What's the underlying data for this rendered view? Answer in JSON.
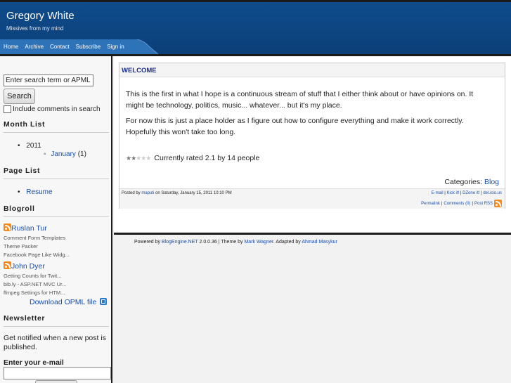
{
  "header": {
    "title": "Gregory White",
    "subtitle": "Missives from my mind",
    "nav": [
      "Home",
      "Archive",
      "Contact",
      "Subscribe",
      "Sign in"
    ]
  },
  "sidebar": {
    "search": {
      "value": "Enter search term or APML url",
      "button": "Search",
      "checkbox_label": "Include comments in search",
      "checked": false
    },
    "month_list": {
      "heading": "Month List",
      "year": "2011",
      "month": "January",
      "count": "(1)"
    },
    "page_list": {
      "heading": "Page List",
      "items": [
        "Resume"
      ]
    },
    "blogroll": {
      "heading": "Blogroll",
      "blogs": [
        {
          "name": "Ruslan Tur",
          "posts": [
            "Comment Form Templates",
            "Theme Packer",
            "Facebook Page Like Widg..."
          ]
        },
        {
          "name": "John Dyer",
          "posts": [
            "Getting Counts for Twit...",
            "bib.ly - ASP.NET MVC Ur...",
            "ffmpeg Settings for HTM..."
          ]
        }
      ],
      "opml": "Download OPML file"
    },
    "newsletter": {
      "heading": "Newsletter",
      "text": "Get notified when a new post is published.",
      "email_label": "Enter your e-mail",
      "email_value": ""
    }
  },
  "post": {
    "title": "WELCOME",
    "paragraph1": "This is the first in what I hope is a continuous stream of stuff that I either think about or have opinions on.  It might be technology, politics, music... whatever... but it's my place.",
    "paragraph2": "For now this is just a place holder as I figure out how to configure everything and make it work correctly. Hopefully this won't take too long.",
    "rating_text": "Currently rated 2.1 by 14 people",
    "rating_value": 2.1,
    "rating_max": 5,
    "categories_label": "Categories:",
    "category": "Blog",
    "posted_by_label": "Posted by",
    "author": "maputi",
    "posted_on": "on Saturday, January 15, 2011 10:10 PM",
    "actions": [
      "E-mail",
      "Kick it!",
      "DZone it!",
      "del.icio.us"
    ],
    "permalink": "Permalink",
    "comments": "Comments (0)",
    "post_rss": "Post RSS"
  },
  "footer": {
    "powered_by": "Powered by",
    "engine": "BlogEngine.NET",
    "version": "2.0.0.36 | Theme by",
    "theme_author": "Mark Wagner",
    "adapted": ". Adapted by",
    "adapter": "Ahmad Masykur"
  },
  "colors": {
    "header": "#0f4c8c",
    "link": "#1b4fa6",
    "title": "#1b2f8a",
    "rss": "#f48a1c"
  }
}
